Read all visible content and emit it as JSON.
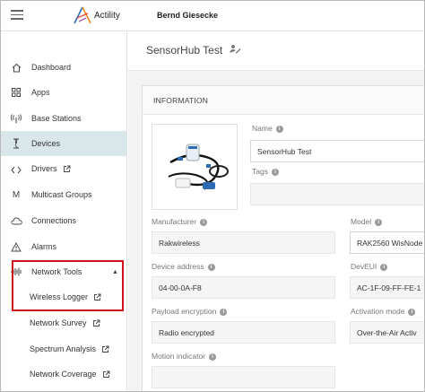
{
  "topbar": {
    "brand": "Actility",
    "user": "Bernd Giesecke"
  },
  "sidebar": {
    "items": [
      {
        "label": "Dashboard",
        "icon": "home-icon"
      },
      {
        "label": "Apps",
        "icon": "apps-grid-icon"
      },
      {
        "label": "Base Stations",
        "icon": "antenna-icon"
      },
      {
        "label": "Devices",
        "icon": "device-icon",
        "active": true
      },
      {
        "label": "Drivers",
        "icon": "code-icon",
        "external": true
      },
      {
        "label": "Multicast Groups",
        "icon": "multicast-icon"
      },
      {
        "label": "Connections",
        "icon": "cloud-icon"
      },
      {
        "label": "Alarms",
        "icon": "warning-icon"
      },
      {
        "label": "Network Tools",
        "icon": "waveform-icon",
        "expanded": true
      }
    ],
    "subitems": [
      {
        "label": "Wireless Logger",
        "external": true
      },
      {
        "label": "Network Survey",
        "external": true
      },
      {
        "label": "Spectrum Analysis",
        "external": true
      },
      {
        "label": "Network Coverage",
        "external": true
      }
    ]
  },
  "main": {
    "title": "SensorHub Test",
    "section": "INFORMATION",
    "fields": {
      "name": {
        "label": "Name",
        "value": "SensorHub Test"
      },
      "tags": {
        "label": "Tags",
        "value": ""
      },
      "manufacturer": {
        "label": "Manufacturer",
        "value": "Rakwireless"
      },
      "model": {
        "label": "Model",
        "value": "RAK2560 WisNode"
      },
      "device_address": {
        "label": "Device address",
        "value": "04-00-0A-F8"
      },
      "deveui": {
        "label": "DevEUI",
        "value": "AC-1F-09-FF-FE-1"
      },
      "payload_encryption": {
        "label": "Payload encryption",
        "value": "Radio encrypted"
      },
      "activation_mode": {
        "label": "Activation mode",
        "value": "Over-the-Air Activ"
      },
      "motion_indicator": {
        "label": "Motion indicator",
        "value": ""
      }
    }
  },
  "colors": {
    "active_bg": "#d9e7ea",
    "highlight": "#d0141c",
    "logo_orange": "#f08a24",
    "logo_blue": "#2d6cb5"
  }
}
